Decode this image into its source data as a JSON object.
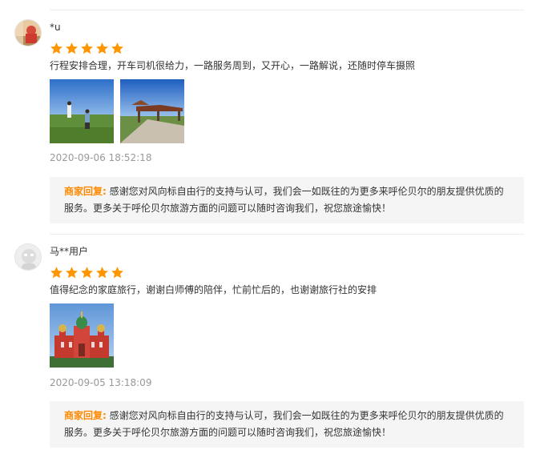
{
  "reviews": [
    {
      "username": "*u",
      "rating": 5,
      "comment": "行程安排合理，开车司机很给力，一路服务周到，又开心，一路解说，还随时停车摄照",
      "photos": [
        "grassland-photo-people",
        "pavilion-photo"
      ],
      "date": "2020-09-06 18:52:18",
      "reply_label": "商家回复:",
      "reply_text": "感谢您对风向标自由行的支持与认可，我们会一如既往的为更多来呼伦贝尔的朋友提供优质的服务。更多关于呼伦贝尔旅游方面的问题可以随时咨询我们，祝您旅途愉快！"
    },
    {
      "username": "马**用户",
      "rating": 5,
      "comment": "值得纪念的家庭旅行，谢谢白师傅的陪伴，忙前忙后的，也谢谢旅行社的安排",
      "photos": [
        "church-photo"
      ],
      "date": "2020-09-05 13:18:09",
      "reply_label": "商家回复:",
      "reply_text": "感谢您对风向标自由行的支持与认可，我们会一如既往的为更多来呼伦贝尔的朋友提供优质的服务。更多关于呼伦贝尔旅游方面的问题可以随时咨询我们，祝您旅途愉快！"
    }
  ],
  "colors": {
    "star": "#ff9500",
    "reply_label": "#ff8a00",
    "date": "#999999",
    "reply_bg": "#f5f5f5"
  }
}
